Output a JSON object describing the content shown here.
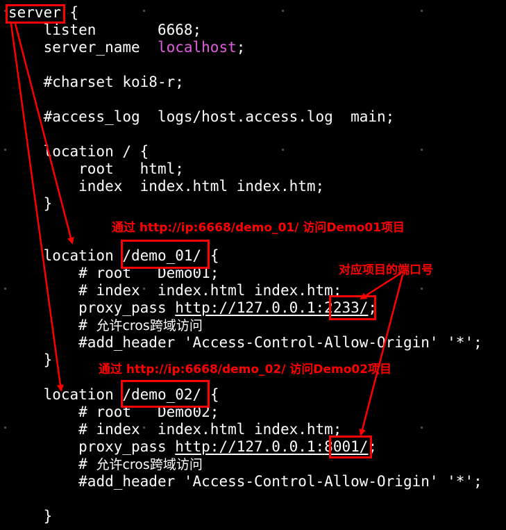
{
  "code_lines": [
    {
      "indent": "",
      "parts": [
        "server",
        " {"
      ]
    },
    {
      "indent": "    ",
      "parts": [
        "listen       6668;"
      ]
    },
    {
      "indent": "    ",
      "parts": [
        "server_name  ",
        "localhost",
        ";"
      ]
    },
    {
      "indent": "    ",
      "parts": [
        "#charset koi8-r;"
      ]
    },
    {
      "indent": "    ",
      "parts": [
        "#access_log  logs/host.access.log  main;"
      ]
    },
    {
      "indent": "    ",
      "parts": [
        "location / {"
      ]
    },
    {
      "indent": "        ",
      "parts": [
        "root   html;"
      ]
    },
    {
      "indent": "        ",
      "parts": [
        "index  index.html index.htm;"
      ]
    },
    {
      "indent": "    ",
      "parts": [
        "}"
      ]
    },
    {
      "indent": "    ",
      "parts": [
        "location ",
        "/demo_01/",
        " {"
      ]
    },
    {
      "indent": "        ",
      "parts": [
        "# root   Demo01;"
      ]
    },
    {
      "indent": "        ",
      "parts": [
        "# index  index.html index.htm;"
      ]
    },
    {
      "indent": "        ",
      "parts": [
        "proxy_pass ",
        "http://127.0.0.1:",
        "2233",
        "/",
        ";"
      ]
    },
    {
      "indent": "        ",
      "parts": [
        "# ",
        "允许cros跨域访问"
      ]
    },
    {
      "indent": "        ",
      "parts": [
        "#add_header 'Access-Control-Allow-Origin' '*';"
      ]
    },
    {
      "indent": "    ",
      "parts": [
        "}"
      ]
    },
    {
      "indent": "    ",
      "parts": [
        "location ",
        "/demo_02/",
        " {"
      ]
    },
    {
      "indent": "        ",
      "parts": [
        "# root   Demo02;"
      ]
    },
    {
      "indent": "        ",
      "parts": [
        "# index  index.html index.htm;"
      ]
    },
    {
      "indent": "        ",
      "parts": [
        "proxy_pass ",
        "http://127.0.0.1:",
        "8001",
        "/",
        ";"
      ]
    },
    {
      "indent": "        ",
      "parts": [
        "# ",
        "允许cros跨域访问"
      ]
    },
    {
      "indent": "        ",
      "parts": [
        "#add_header 'Access-Control-Allow-Origin' '*';"
      ]
    },
    {
      "indent": "    ",
      "parts": [
        "}"
      ]
    }
  ],
  "annotations": {
    "demo01_note": "通过 http://ip:6668/demo_01/ 访问Demo01项目",
    "demo02_note": "通过 http://ip:6668/demo_02/ 访问Demo02项目",
    "port_note": "对应项目的端口号"
  },
  "colors": {
    "background": "#000000",
    "text": "#ffffff",
    "keyword_pink": "#e25ce2",
    "annotation_red": "#ff0000"
  }
}
